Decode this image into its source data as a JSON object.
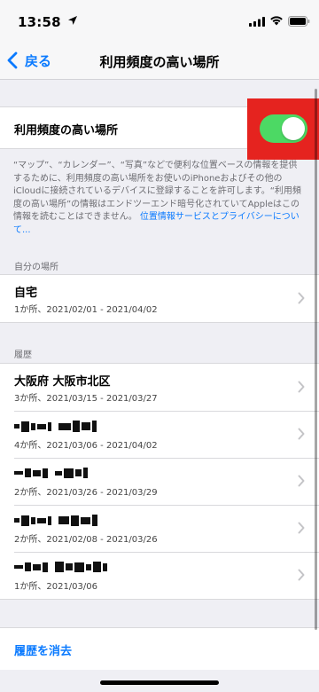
{
  "status": {
    "time": "13:58",
    "location_icon": "location-arrow-icon",
    "signal_icon": "cellular-signal-icon",
    "wifi_icon": "wifi-icon",
    "battery_icon": "battery-icon"
  },
  "nav": {
    "back_label": "戻る",
    "title": "利用頻度の高い場所"
  },
  "toggle_row": {
    "label": "利用頻度の高い場所",
    "enabled": true,
    "on_color": "#4cd964",
    "highlight_color": "#e5231f"
  },
  "description": {
    "text": "“マップ”、“カレンダー”、“写真”などで便利な位置ベースの情報を提供するために、利用頻度の高い場所をお使いのiPhoneおよびその他のiCloudに接続されているデバイスに登録することを許可します。“利用頻度の高い場所”の情報はエンドツーエンド暗号化されていてAppleはこの情報を読むことはできません。",
    "link": "位置情報サービスとプライバシーについて..."
  },
  "my_places": {
    "header": "自分の場所",
    "items": [
      {
        "title": "自宅",
        "subtitle": "1か所、2021/02/01 - 2021/04/02"
      }
    ]
  },
  "history": {
    "header": "履歴",
    "items": [
      {
        "title": "大阪府 大阪市北区",
        "subtitle": "3か所、2021/03/15 - 2021/03/27",
        "redacted": false
      },
      {
        "title": "",
        "subtitle": "4か所、2021/03/06 - 2021/04/02",
        "redacted": true
      },
      {
        "title": "",
        "subtitle": "2か所、2021/03/26 - 2021/03/29",
        "redacted": true
      },
      {
        "title": "",
        "subtitle": "2か所、2021/02/08 - 2021/03/26",
        "redacted": true
      },
      {
        "title": "",
        "subtitle": "1か所、2021/03/06",
        "redacted": true
      }
    ]
  },
  "clear_history": {
    "label": "履歴を消去"
  },
  "colors": {
    "accent": "#0a7aff",
    "background": "#efeff4"
  }
}
